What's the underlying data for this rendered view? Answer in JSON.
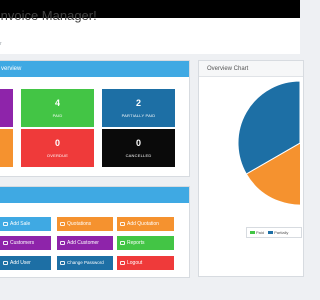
{
  "header": {
    "title": "Invoice Manager!",
    "subtitle": "r"
  },
  "overview": {
    "title": "verview",
    "tiles": [
      {
        "number": "",
        "label": "",
        "color": "#8e24aa"
      },
      {
        "number": "4",
        "label": "PAID",
        "color": "#43c545"
      },
      {
        "number": "2",
        "label": "PARTIALLY PAID",
        "color": "#1d6fa5"
      },
      {
        "number": "",
        "label": "",
        "color": "#f5922f"
      },
      {
        "number": "0",
        "label": "OVERDUE",
        "color": "#ef3a3a"
      },
      {
        "number": "0",
        "label": "CANCELLED",
        "color": "#0a0a0a"
      }
    ]
  },
  "quick_actions": {
    "buttons": [
      {
        "label": "Add Sale",
        "color": "#3fa9e3",
        "icon": "plus-icon"
      },
      {
        "label": "Quotations",
        "color": "#f5922f",
        "icon": "file-icon"
      },
      {
        "label": "Add Quotation",
        "color": "#f5922f",
        "icon": "file-plus-icon"
      },
      {
        "label": "Customers",
        "color": "#8e24aa",
        "icon": "users-icon"
      },
      {
        "label": "Add Customer",
        "color": "#8e24aa",
        "icon": "user-plus-icon"
      },
      {
        "label": "Reports",
        "color": "#43c545",
        "icon": "chart-icon"
      },
      {
        "label": "Add User",
        "color": "#1d6fa5",
        "icon": "user-plus-icon"
      },
      {
        "label": "Change Password",
        "color": "#1d6fa5",
        "icon": "key-icon"
      },
      {
        "label": "Logout",
        "color": "#ef3a3a",
        "icon": "logout-icon"
      }
    ]
  },
  "overview_chart": {
    "title": "Overview Chart"
  },
  "chart_data": {
    "type": "pie",
    "title": "Overview Chart",
    "legend_position": "bottom-right",
    "slices": [
      {
        "label": "Paid",
        "value": 4,
        "color": "#f5922f"
      },
      {
        "label": "Partially",
        "value": 2,
        "color": "#1d6fa5"
      }
    ],
    "legend": [
      {
        "label": "Paid",
        "color": "#43c545"
      },
      {
        "label": "Partially",
        "color": "#1d6fa5"
      }
    ]
  }
}
